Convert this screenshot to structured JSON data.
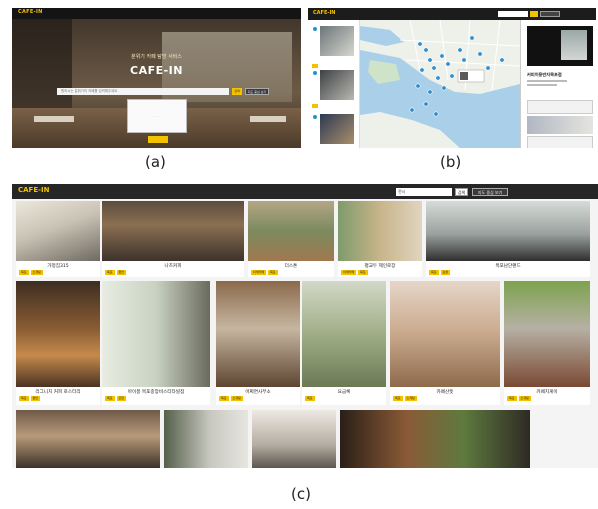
{
  "panel_a": {
    "logo": "CAFE-IN",
    "subtitle": "분위기 카페 탐방 서비스",
    "brand": "CAFE-IN",
    "search_placeholder": "원하시는 분위기의 카페를 입력해주세요",
    "search_button": "검색",
    "map_button": "지도 중심 보기"
  },
  "panel_b": {
    "logo": "CAFE-IN",
    "selected_cafe": "커피이용반지목포점"
  },
  "captions": {
    "a": "(a)",
    "b": "(b)",
    "c": "(c)"
  },
  "panel_c": {
    "logo": "CAFE-IN",
    "search_value": "전시",
    "search_button": "검색",
    "map_button": "지도 중심 보기",
    "row1": [
      {
        "name": "가정집315",
        "tags": [
          "목포",
          "소개팅"
        ]
      },
      {
        "name": "나즈커피",
        "tags": [
          "목포",
          "편안"
        ]
      },
      {
        "name": "더스톤",
        "tags": [
          "이색카페",
          "목포"
        ]
      },
      {
        "name": "평교두 제인로장",
        "tags": [
          "이색카페",
          "목포"
        ]
      },
      {
        "name": "목포남단랜드",
        "tags": [
          "목포",
          "감성"
        ]
      }
    ],
    "row2": [
      {
        "name": "리그니치 커피 로스터리",
        "tags": [
          "목포",
          "편안"
        ]
      },
      {
        "name": "아이몽 목포중앙비스티타널점",
        "tags": [
          "목포",
          "모던"
        ]
      },
      {
        "name": "어쩌면사무소",
        "tags": [
          "목포",
          "소개팅"
        ]
      },
      {
        "name": "요금록",
        "tags": [
          "목포"
        ]
      },
      {
        "name": "카페산뜻",
        "tags": [
          "목포",
          "소개팅"
        ]
      },
      {
        "name": "카페치게이",
        "tags": [
          "목포",
          "소개팅"
        ]
      }
    ]
  }
}
